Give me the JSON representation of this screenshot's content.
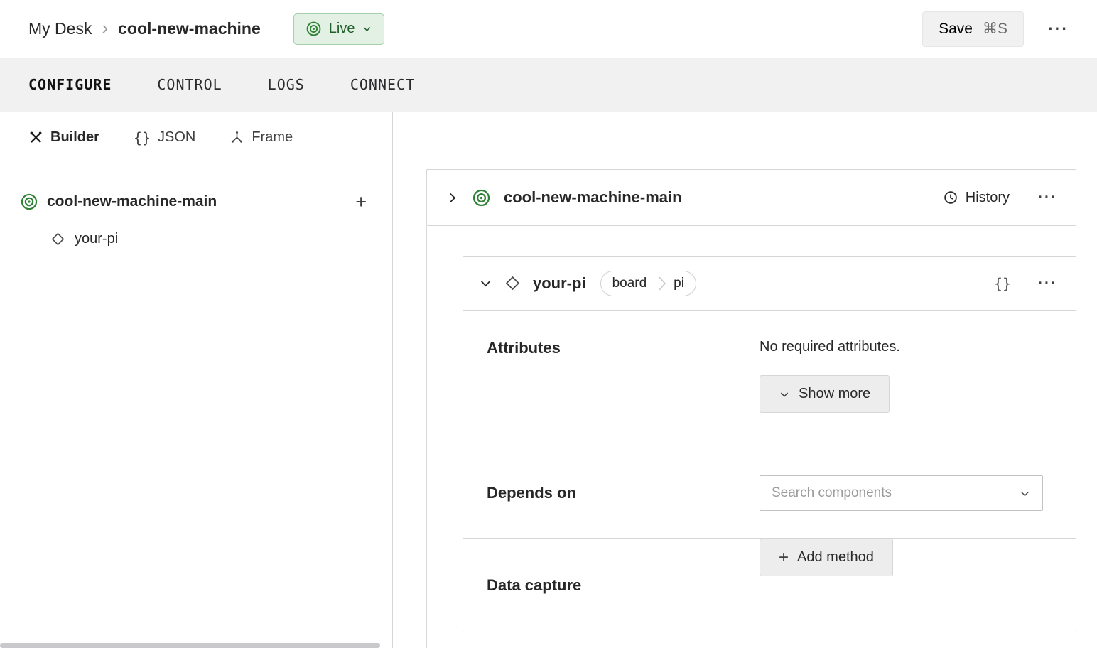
{
  "header": {
    "breadcrumb_root": "My Desk",
    "breadcrumb_sep": "›",
    "breadcrumb_current": "cool-new-machine",
    "live_label": "Live",
    "save_label": "Save",
    "save_shortcut": "⌘S",
    "menu_icon": "···"
  },
  "tabs": [
    {
      "label": "CONFIGURE",
      "active": true
    },
    {
      "label": "CONTROL",
      "active": false
    },
    {
      "label": "LOGS",
      "active": false
    },
    {
      "label": "CONNECT",
      "active": false
    }
  ],
  "sidebar": {
    "builder_label": "Builder",
    "json_glyph": "{}",
    "json_label": "JSON",
    "frame_label": "Frame",
    "machine_label": "cool-new-machine-main",
    "add_icon": "+",
    "component_label": "your-pi"
  },
  "main": {
    "machine_title": "cool-new-machine-main",
    "history_label": "History",
    "menu_icon": "···",
    "component": {
      "title": "your-pi",
      "badge_type": "board",
      "badge_model": "pi",
      "json_glyph": "{}",
      "menu_icon": "···",
      "attributes_label": "Attributes",
      "attributes_empty": "No required attributes.",
      "show_more_label": "Show more",
      "depends_label": "Depends on",
      "depends_placeholder": "Search components",
      "capture_label": "Data capture",
      "add_method_plus": "+",
      "add_method_label": "Add method"
    }
  },
  "colors": {
    "green": "#2f8136",
    "green_dark": "#215f2a",
    "green_bg": "#e3f1e5",
    "green_border": "#a5d0aa"
  }
}
